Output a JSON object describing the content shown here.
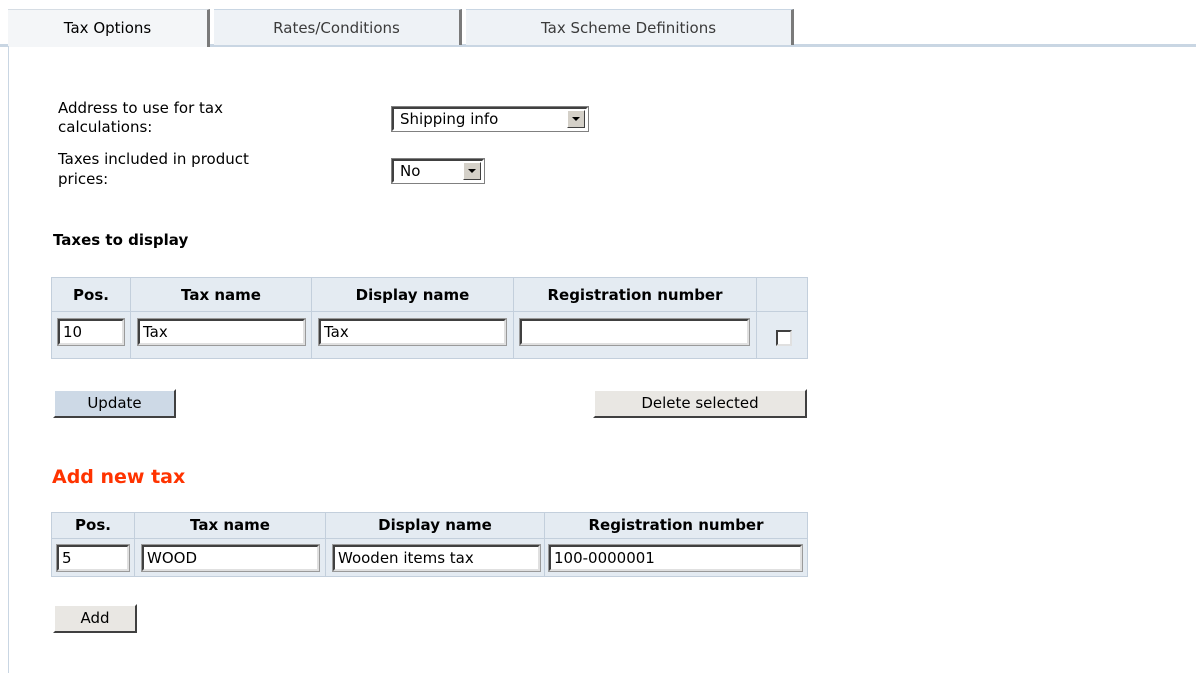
{
  "tabs": [
    {
      "label": "Tax Options"
    },
    {
      "label": "Rates/Conditions"
    },
    {
      "label": "Tax Scheme Definitions"
    }
  ],
  "options": {
    "address_label_line1": "Address to use for tax",
    "address_label_line2": "calculations:",
    "address_value": "Shipping info",
    "included_label_line1": "Taxes included in product",
    "included_label_line2": "prices:",
    "included_value": "No"
  },
  "display": {
    "title": "Taxes to display",
    "headers": [
      "Pos.",
      "Tax name",
      "Display name",
      "Registration number"
    ],
    "row": {
      "pos": "10",
      "tax_name": "Tax",
      "display_name": "Tax",
      "registration": ""
    },
    "update_label": "Update",
    "delete_label": "Delete selected"
  },
  "add": {
    "title": "Add new tax",
    "headers": [
      "Pos.",
      "Tax name",
      "Display name",
      "Registration number"
    ],
    "row": {
      "pos": "5",
      "tax_name": "WOOD",
      "display_name": "Wooden items tax",
      "registration": "100-0000001"
    },
    "add_label": "Add"
  },
  "colors": {
    "accent": "#ff3300",
    "grid_bg": "#e4ebf2",
    "tab_border": "#c9d6e3"
  }
}
